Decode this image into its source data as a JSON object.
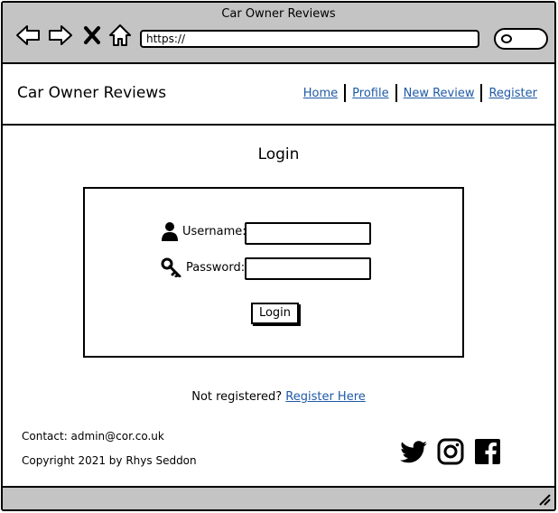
{
  "browser": {
    "title": "Car Owner Reviews",
    "url": "https://",
    "icons": [
      "back-arrow-icon",
      "forward-arrow-icon",
      "close-x-icon",
      "home-icon",
      "search-icon"
    ]
  },
  "header": {
    "brand": "Car Owner Reviews",
    "nav": [
      "Home",
      "Profile",
      "New Review",
      "Register"
    ]
  },
  "main": {
    "title": "Login",
    "username_label": "Username:",
    "password_label": "Password:",
    "username_value": "",
    "password_value": "",
    "login_button": "Login",
    "register_prompt": "Not registered?",
    "register_link": "Register Here"
  },
  "footer": {
    "contact": "Contact: admin@cor.co.uk",
    "copyright": "Copyright 2021 by Rhys Seddon",
    "social": [
      "twitter-icon",
      "instagram-icon",
      "facebook-icon"
    ]
  },
  "colors": {
    "chrome": "#c4c4c4",
    "link": "#1f5aa6",
    "border": "#000000"
  }
}
